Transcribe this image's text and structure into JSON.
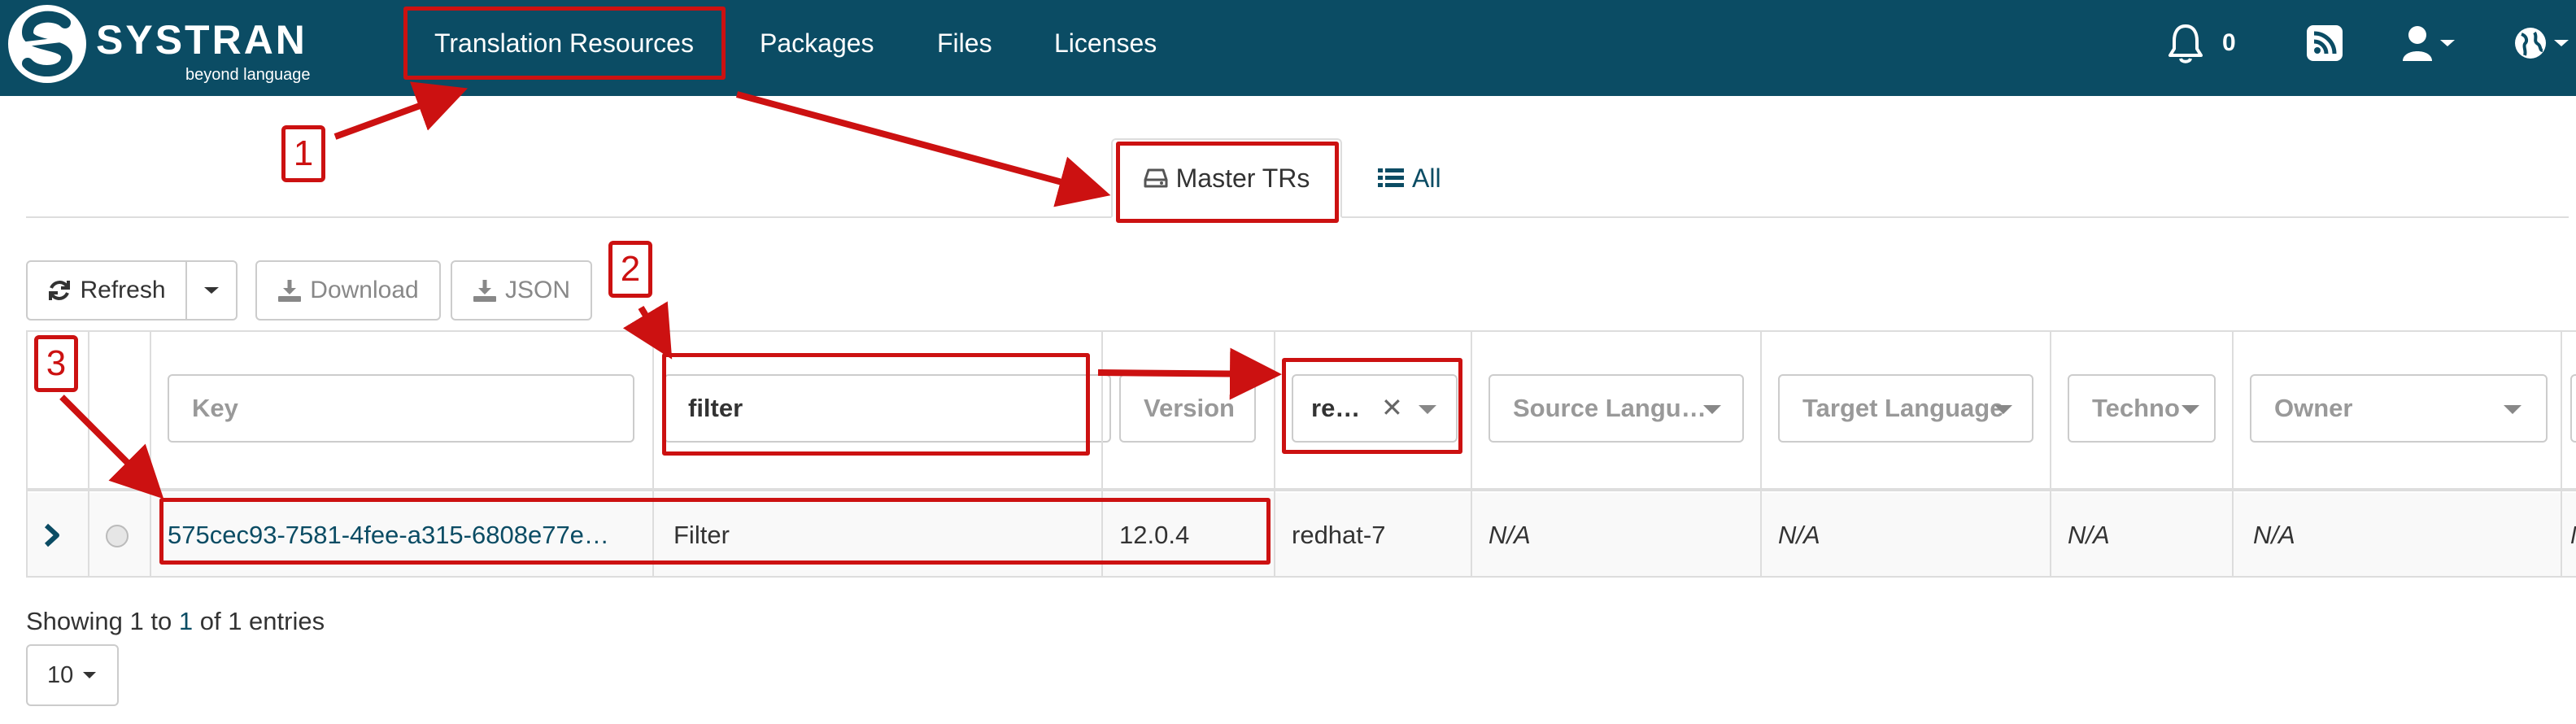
{
  "app": {
    "brand_name": "SYSTRAN",
    "brand_tagline": "beyond language"
  },
  "nav": {
    "items": [
      "Translation Resources",
      "Packages",
      "Files",
      "Licenses"
    ],
    "notification_count": "0"
  },
  "tabs": {
    "master_label": "Master TRs",
    "all_label": "All"
  },
  "toolbar": {
    "refresh_label": "Refresh",
    "download_label": "Download",
    "json_label": "JSON"
  },
  "filters": {
    "key_placeholder": "Key",
    "name_value": "filter",
    "version_placeholder": "Version",
    "os_value": "re…",
    "source_lang_placeholder": "Source Langu…",
    "target_lang_placeholder": "Target Language",
    "techno_placeholder": "Techno",
    "owner_placeholder": "Owner"
  },
  "row": {
    "key": "575cec93-7581-4fee-a315-6808e77e…",
    "name": "Filter",
    "version": "12.0.4",
    "os": "redhat-7",
    "source_lang": "N/A",
    "target_lang": "N/A",
    "techno": "N/A",
    "owner": "N/A",
    "extra": "N"
  },
  "footer": {
    "showing_prefix": "Showing 1 to ",
    "showing_to": "1",
    "showing_suffix": " of 1 entries",
    "page_size": "10"
  },
  "annotations": [
    "1",
    "2",
    "3"
  ],
  "colors": {
    "navbar": "#0b4c64",
    "annotation": "#cc1111",
    "link": "#0b4c64"
  }
}
